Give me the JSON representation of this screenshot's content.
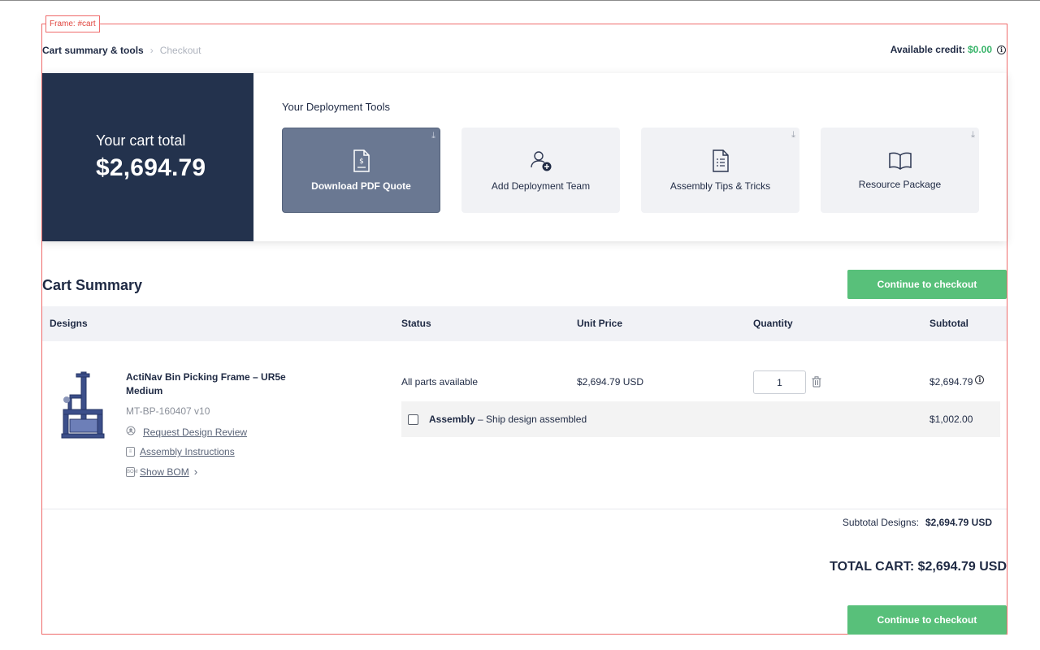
{
  "frame_label": "Frame: #cart",
  "breadcrumb": {
    "active": "Cart summary & tools",
    "separator": "›",
    "next": "Checkout"
  },
  "credit": {
    "label": "Available credit:",
    "value": "$0.00"
  },
  "cart_total": {
    "label": "Your cart total",
    "value": "$2,694.79"
  },
  "tools": {
    "title": "Your Deployment Tools",
    "items": [
      {
        "label": "Download PDF Quote",
        "icon": "pdf-quote-icon"
      },
      {
        "label": "Add Deployment Team",
        "icon": "add-user-icon"
      },
      {
        "label": "Assembly Tips & Tricks",
        "icon": "list-document-icon"
      },
      {
        "label": "Resource Package",
        "icon": "open-book-icon"
      }
    ]
  },
  "summary": {
    "title": "Cart Summary",
    "checkout_label": "Continue to checkout",
    "columns": [
      "Designs",
      "Status",
      "Unit Price",
      "Quantity",
      "Subtotal"
    ],
    "item": {
      "name": "ActiNav Bin Picking Frame – UR5e Medium",
      "sku": "MT-BP-160407 v10",
      "links": [
        "Request Design Review",
        "Assembly Instructions",
        "Show BOM"
      ],
      "status": "All parts available",
      "unit_price": "$2,694.79 USD",
      "quantity": "1",
      "subtotal": "$2,694.79"
    },
    "assembly": {
      "label": "Assembly",
      "desc": " – Ship design assembled",
      "price": "$1,002.00"
    },
    "subtotal_designs_label": "Subtotal Designs:",
    "subtotal_designs_value": "$2,694.79 USD",
    "total_cart": "TOTAL CART: $2,694.79 USD"
  },
  "colors": {
    "navy": "#23324d",
    "accent_green": "#58c07a",
    "credit_green": "#39b46a",
    "frame_red": "#ef6b6b"
  }
}
